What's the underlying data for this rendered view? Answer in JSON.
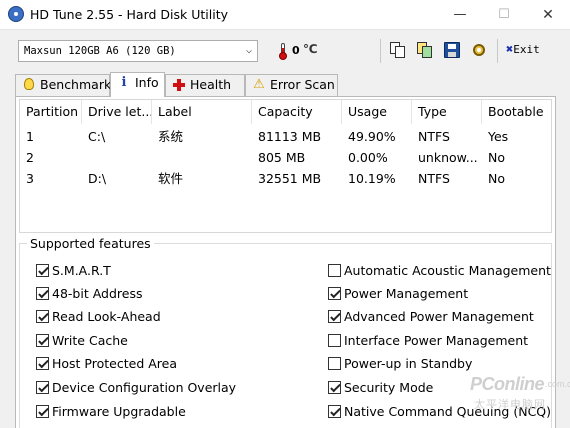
{
  "window": {
    "title": "HD Tune 2.55 - Hard Disk Utility",
    "minimize_glyph": "—",
    "maximize_glyph": "☐",
    "close_glyph": "✕"
  },
  "toolbar": {
    "drive_selected": "Maxsun  120GB A6 (120 GB)",
    "dropdown_glyph": "⌵",
    "temperature_value": "0",
    "temperature_unit": "℃",
    "exit_label": "Exit",
    "exit_glyph": "✖",
    "icons": [
      "copy-text-icon",
      "copy-info-icon",
      "save-icon",
      "options-icon"
    ]
  },
  "tabs": [
    {
      "label": "Benchmark",
      "icon": "lightbulb-icon"
    },
    {
      "label": "Info",
      "icon": "info-icon",
      "active": true
    },
    {
      "label": "Health",
      "icon": "health-cross-icon"
    },
    {
      "label": "Error Scan",
      "icon": "warning-icon"
    }
  ],
  "partitions": {
    "columns": [
      "Partition",
      "Drive let...",
      "Label",
      "Capacity",
      "Usage",
      "Type",
      "Bootable"
    ],
    "rows": [
      [
        "1",
        "C:\\",
        "系统",
        "81113 MB",
        "49.90%",
        "NTFS",
        "Yes"
      ],
      [
        "2",
        "",
        "",
        "805 MB",
        "0.00%",
        "unknow...",
        "No"
      ],
      [
        "3",
        "D:\\",
        "软件",
        "32551 MB",
        "10.19%",
        "NTFS",
        "No"
      ]
    ]
  },
  "features": {
    "legend": "Supported features",
    "left": [
      {
        "label": "S.M.A.R.T",
        "checked": true
      },
      {
        "label": "48-bit Address",
        "checked": true
      },
      {
        "label": "Read Look-Ahead",
        "checked": true
      },
      {
        "label": "Write Cache",
        "checked": true
      },
      {
        "label": "Host Protected Area",
        "checked": true
      },
      {
        "label": "Device Configuration Overlay",
        "checked": true
      },
      {
        "label": "Firmware Upgradable",
        "checked": true
      }
    ],
    "right": [
      {
        "label": "Automatic Acoustic Management",
        "checked": false
      },
      {
        "label": "Power Management",
        "checked": true
      },
      {
        "label": "Advanced Power Management",
        "checked": true
      },
      {
        "label": "Interface Power Management",
        "checked": false
      },
      {
        "label": "Power-up in Standby",
        "checked": false
      },
      {
        "label": "Security Mode",
        "checked": true
      },
      {
        "label": "Native Command Queuing (NCQ)",
        "checked": true
      }
    ]
  },
  "watermark": {
    "brand": "PConline",
    "dot": ".com.cn",
    "sub": "太平洋电脑网"
  }
}
